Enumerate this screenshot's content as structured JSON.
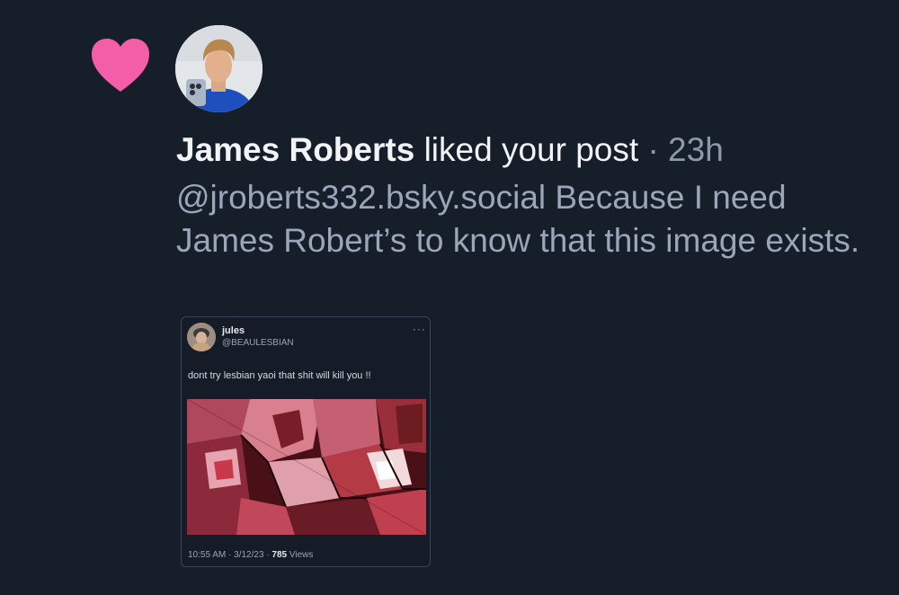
{
  "notification": {
    "icon": "heart-icon",
    "heart_color": "#f45ea8",
    "user_name": "James Roberts",
    "action": "liked your post",
    "separator": "·",
    "time": "23h",
    "post_text": "@jroberts332.bsky.social Because I need James Robert’s to know that this image exists."
  },
  "quoted_post": {
    "author_name": "jules",
    "author_handle": "@BEAULESBIAN",
    "more_icon": "more-horizontal-icon",
    "more_glyph": "···",
    "text": "dont try lesbian yaoi that shit will kill you !!",
    "image_description_icon": "comic-image",
    "timestamp": "10:55 AM · 3/12/23 ·",
    "views_count": "785",
    "views_label": "Views"
  }
}
